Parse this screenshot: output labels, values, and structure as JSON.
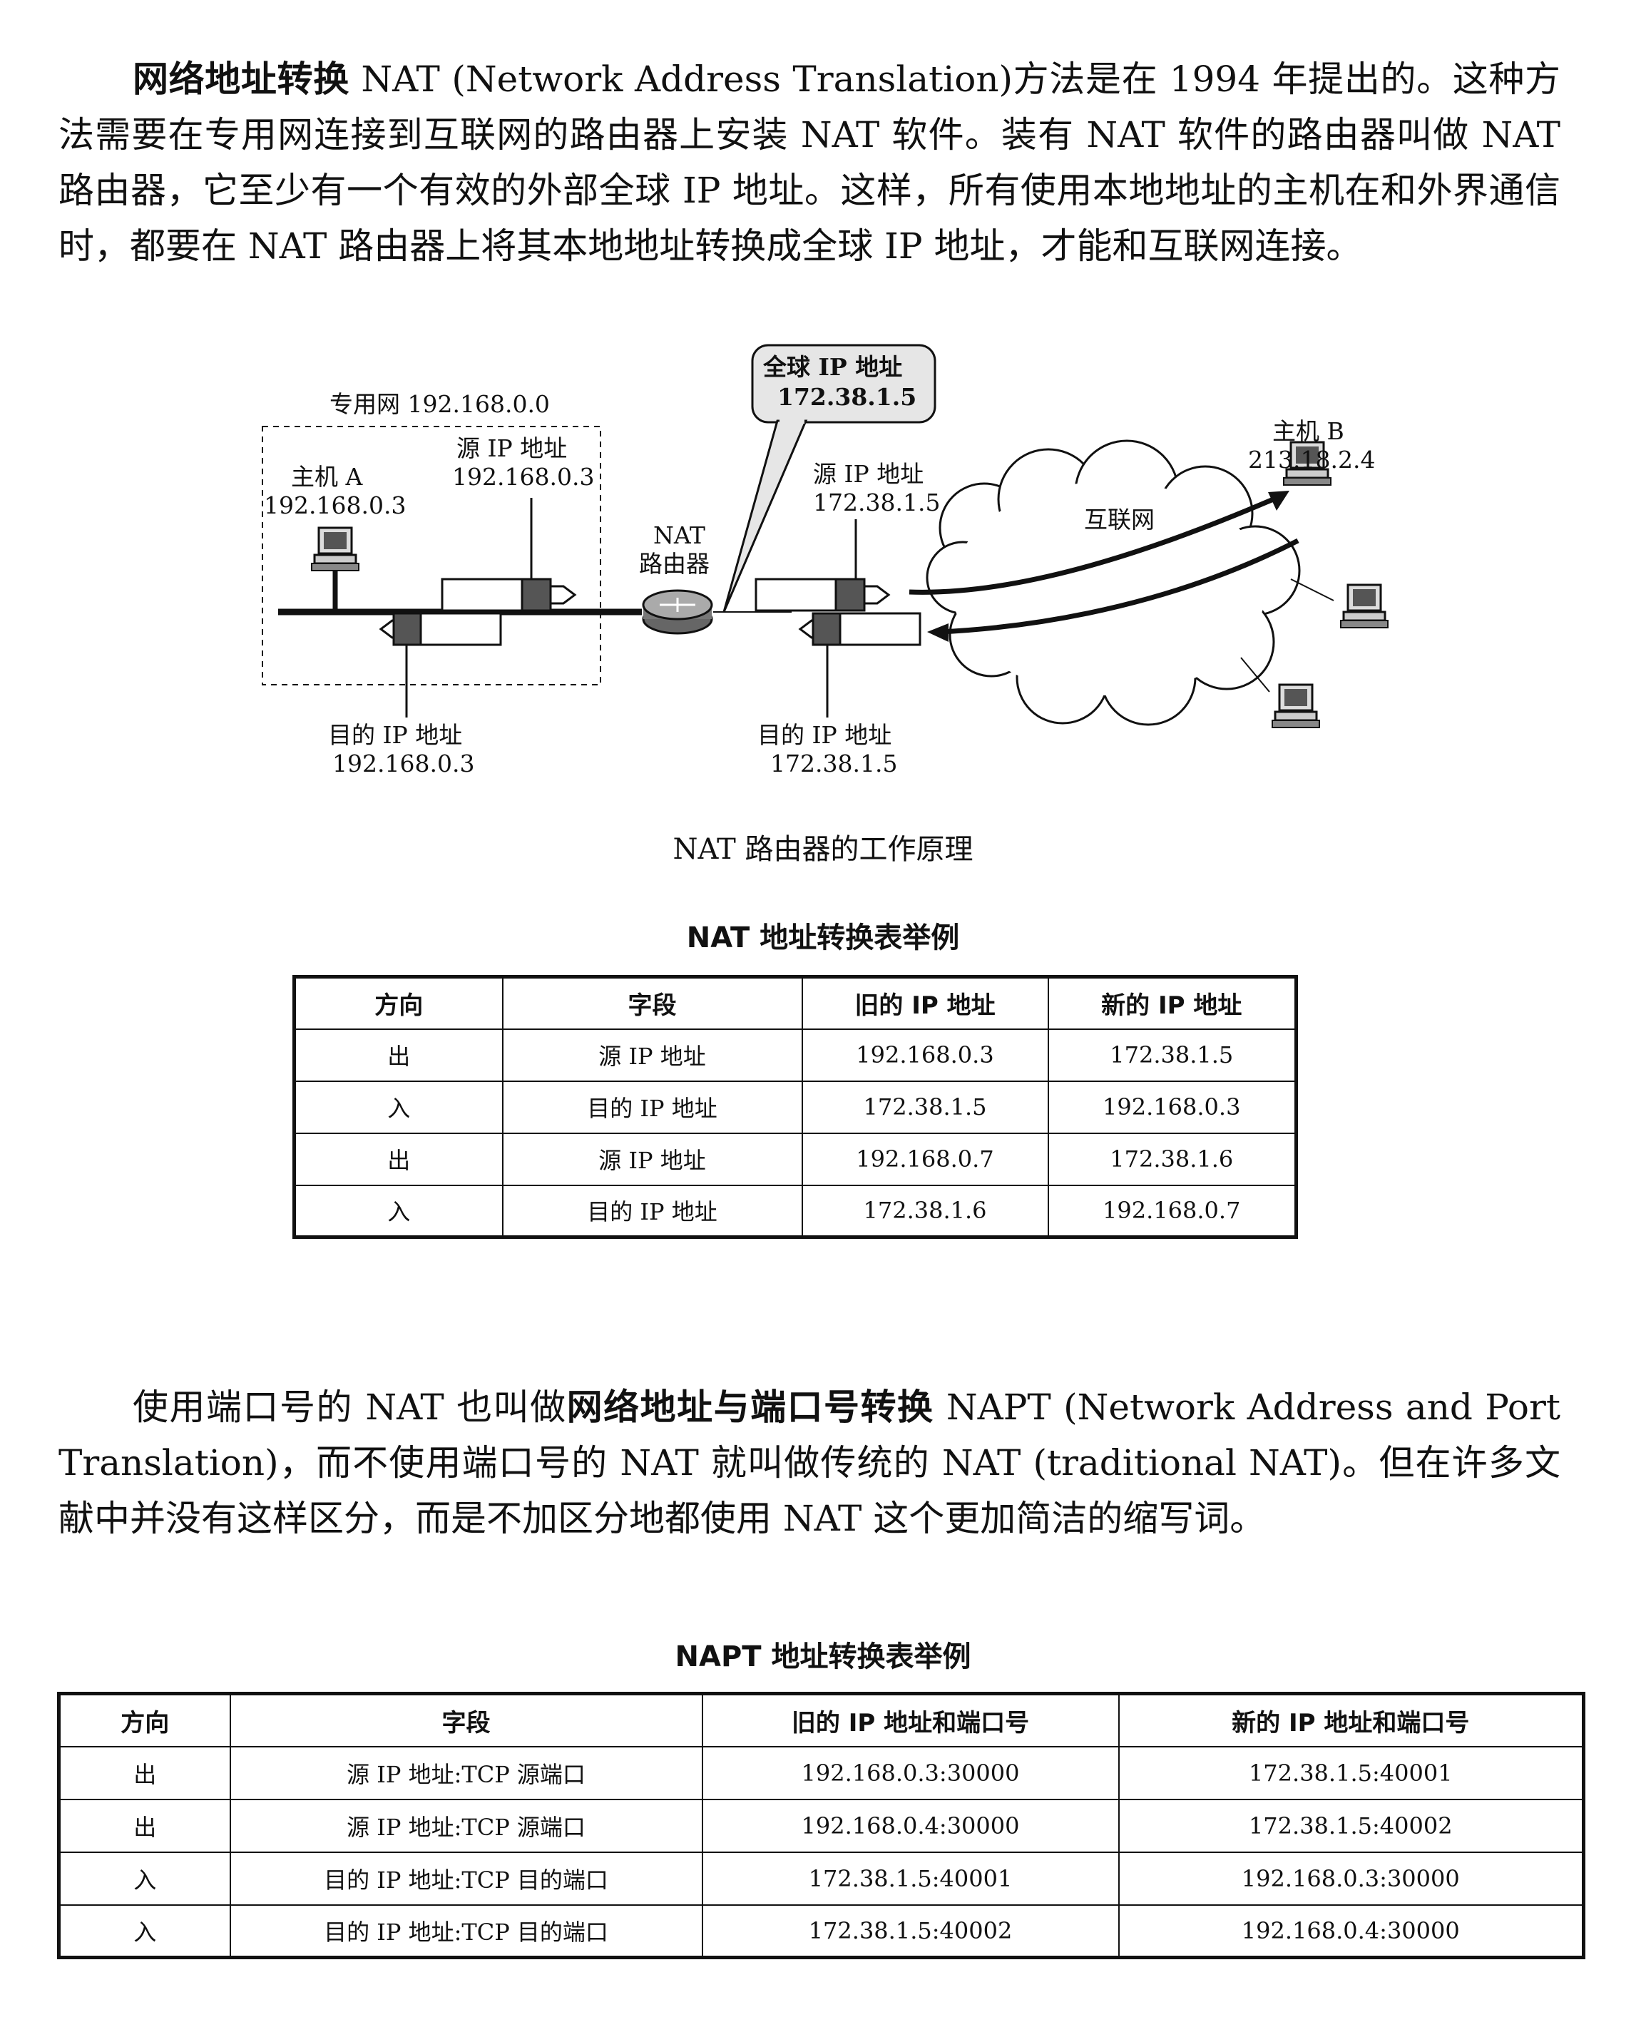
{
  "intro": {
    "term": "网络地址转换",
    "text": " NAT (Network Address Translation)方法是在 1994 年提出的。这种方法需要在专用网连接到互联网的路由器上安装 NAT 软件。装有 NAT 软件的路由器叫做 NAT 路由器，它至少有一个有效的外部全球 IP 地址。这样，所有使用本地地址的主机在和外界通信时，都要在 NAT 路由器上将其本地地址转换成全球 IP 地址，才能和互联网连接。"
  },
  "diagram": {
    "callout_line1": "全球 IP 地址",
    "callout_line2": "172.38.1.5",
    "private_net": "专用网 192.168.0.0",
    "host_a_name": "主机 A",
    "host_a_ip": "192.168.0.3",
    "src_left_label": "源 IP 地址",
    "src_left_ip": "192.168.0.3",
    "nat_line1": "NAT",
    "nat_line2": "路由器",
    "src_right_label": "源 IP 地址",
    "src_right_ip": "172.38.1.5",
    "internet": "互联网",
    "host_b_name": "主机 B",
    "host_b_ip": "213.18.2.4",
    "dst_left_label": "目的 IP 地址",
    "dst_left_ip": "192.168.0.3",
    "dst_right_label": "目的 IP 地址",
    "dst_right_ip": "172.38.1.5",
    "icons": [
      "computer-icon",
      "router-icon",
      "cloud-icon",
      "packet-icon"
    ]
  },
  "figure_caption": "NAT 路由器的工作原理",
  "nat_table": {
    "title": "NAT 地址转换表举例",
    "headers": [
      "方向",
      "字段",
      "旧的 IP 地址",
      "新的 IP 地址"
    ],
    "rows": [
      [
        "出",
        "源 IP 地址",
        "192.168.0.3",
        "172.38.1.5"
      ],
      [
        "入",
        "目的 IP 地址",
        "172.38.1.5",
        "192.168.0.3"
      ],
      [
        "出",
        "源 IP 地址",
        "192.168.0.7",
        "172.38.1.6"
      ],
      [
        "入",
        "目的 IP 地址",
        "172.38.1.6",
        "192.168.0.7"
      ]
    ]
  },
  "para2": {
    "pre": "使用端口号的 NAT 也叫做",
    "term": "网络地址与端口号转换",
    "post": " NAPT (Network Address and Port Translation)，而不使用端口号的 NAT 就叫做传统的 NAT (traditional NAT)。但在许多文献中并没有这样区分，而是不加区分地都使用 NAT 这个更加简洁的缩写词。"
  },
  "napt_table": {
    "title": "NAPT 地址转换表举例",
    "headers": [
      "方向",
      "字段",
      "旧的 IP 地址和端口号",
      "新的 IP 地址和端口号"
    ],
    "rows": [
      [
        "出",
        "源 IP 地址:TCP 源端口",
        "192.168.0.3:30000",
        "172.38.1.5:40001"
      ],
      [
        "出",
        "源 IP 地址:TCP 源端口",
        "192.168.0.4:30000",
        "172.38.1.5:40002"
      ],
      [
        "入",
        "目的 IP 地址:TCP 目的端口",
        "172.38.1.5:40001",
        "192.168.0.3:30000"
      ],
      [
        "入",
        "目的 IP 地址:TCP 目的端口",
        "172.38.1.5:40002",
        "192.168.0.4:30000"
      ]
    ]
  }
}
